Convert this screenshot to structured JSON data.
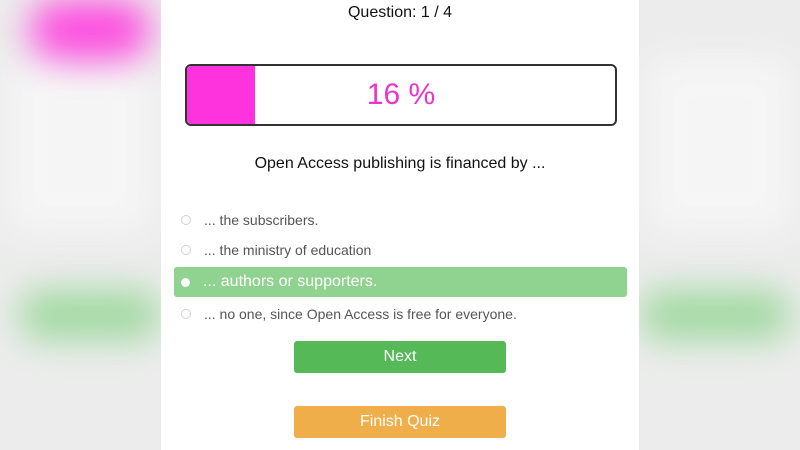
{
  "quiz": {
    "counter": "Question: 1 / 4",
    "progress": {
      "percent": 16,
      "label": "16 %"
    },
    "question": "Open Access publishing is financed by ...",
    "options": [
      {
        "label": "... the subscribers.",
        "selected": false
      },
      {
        "label": "... the ministry of education",
        "selected": false
      },
      {
        "label": "... authors or supporters.",
        "selected": true
      },
      {
        "label": "... no one, since Open Access is free for everyone.",
        "selected": false
      }
    ],
    "next_label": "Next",
    "finish_label": "Finish Quiz"
  },
  "colors": {
    "progress_fill": "#ff33dd",
    "progress_text": "#ee33cc",
    "selected_option": "#90d28f",
    "next_button": "#55b957",
    "finish_button": "#f0ae4a"
  }
}
